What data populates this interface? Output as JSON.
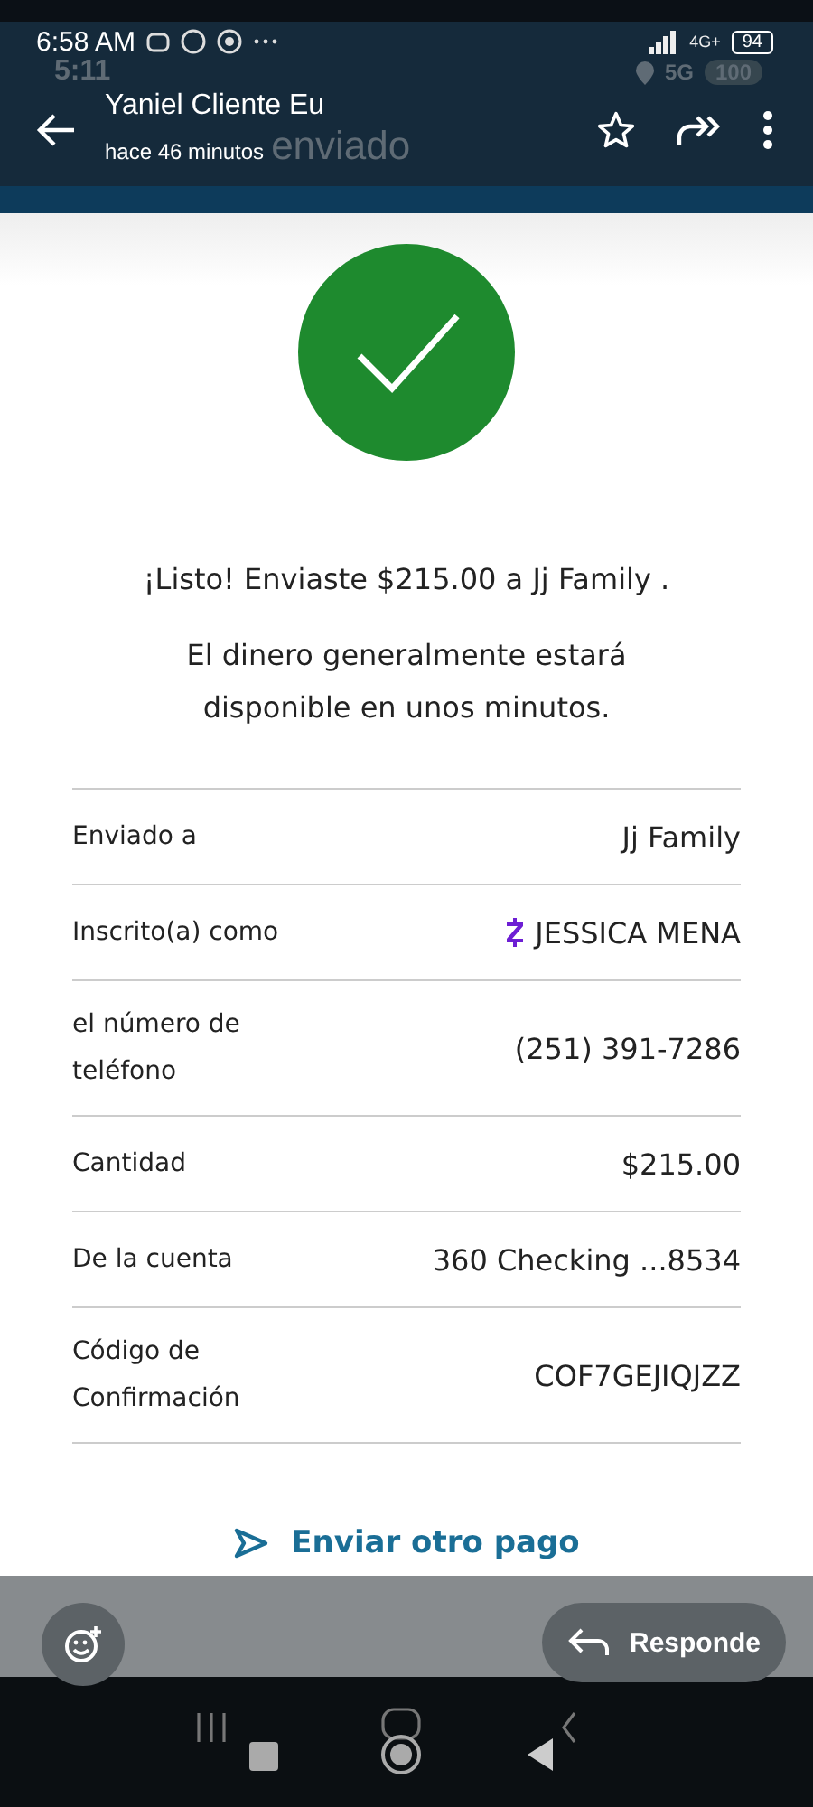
{
  "status_bar": {
    "time": "6:58 AM",
    "network": "4G+",
    "battery": "94"
  },
  "underlying_status_bar": {
    "time": "5:11",
    "network": "5G",
    "battery": "100"
  },
  "viewer_header": {
    "title": "Yaniel Cliente Eu",
    "subtitle": "hace 46 minutos",
    "underlying_title": "enviado"
  },
  "confirmation": {
    "message": "¡Listo! Enviaste $215.00 a Jj Family .",
    "note": "El dinero generalmente estará disponible en unos minutos.",
    "details": [
      {
        "label": "Enviado a",
        "value": "Jj Family",
        "kind": "plain"
      },
      {
        "label": "Inscrito(a) como",
        "value": "JESSICA MENA",
        "kind": "zelle"
      },
      {
        "label": "el número de teléfono",
        "value": "(251) 391-7286",
        "kind": "plain"
      },
      {
        "label": "Cantidad",
        "value": "$215.00",
        "kind": "plain"
      },
      {
        "label": "De la cuenta",
        "value": "360 Checking ...8534",
        "kind": "plain"
      },
      {
        "label": "Código de Confirmación",
        "value": "COF7GEJIQJZZ",
        "kind": "plain"
      }
    ],
    "action": "Enviar otro pago"
  },
  "reply_bar": {
    "reply": "Responde"
  }
}
